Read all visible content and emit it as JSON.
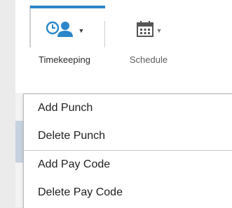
{
  "toolbar": {
    "timekeeping": {
      "label": "Timekeeping",
      "icon": "clock-person-icon"
    },
    "schedule": {
      "label": "Schedule",
      "icon": "calendar-icon"
    }
  },
  "menu": {
    "group1": [
      "Add Punch",
      "Delete Punch"
    ],
    "group2": [
      "Add Pay Code",
      "Delete Pay Code"
    ]
  },
  "colors": {
    "accent": "#2a86c9",
    "icon": "#2a86c9",
    "schedule_icon": "#555555"
  }
}
